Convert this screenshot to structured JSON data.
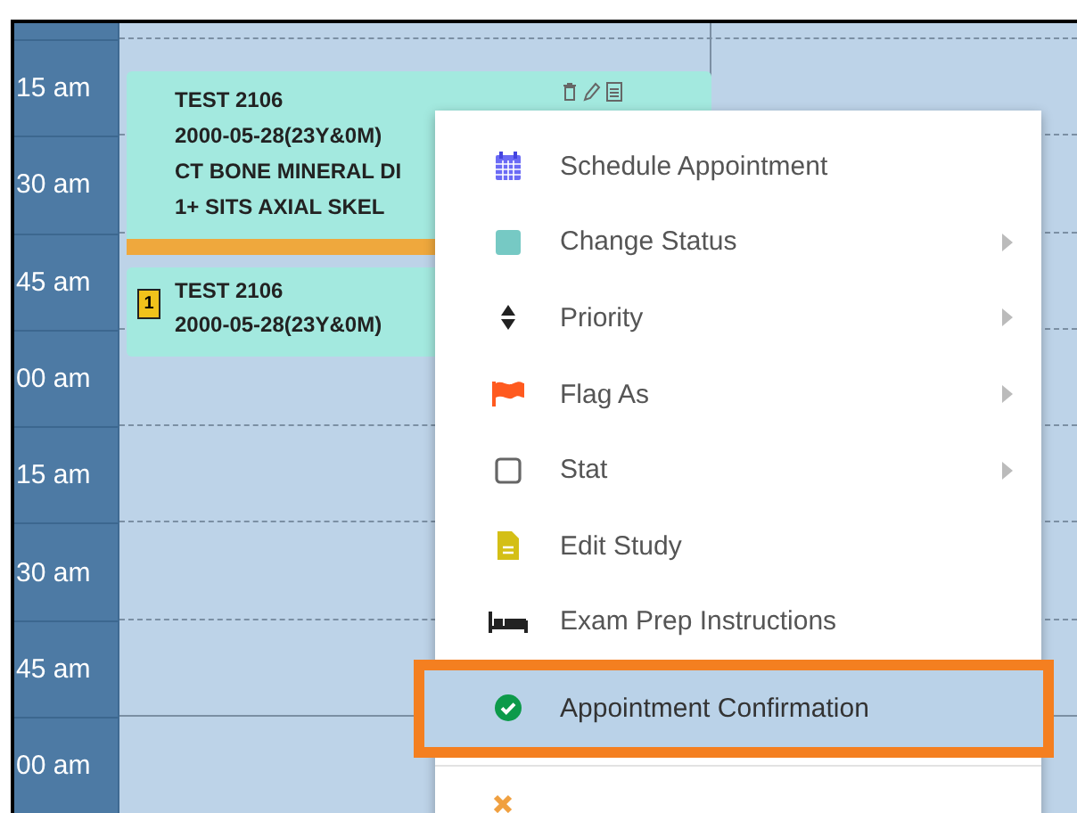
{
  "time_labels": [
    "15 am",
    "30 am",
    "45 am",
    "00 am",
    "15 am",
    "30 am",
    "45 am",
    "00 am"
  ],
  "appointments": [
    {
      "lines": [
        "TEST 2106",
        "2000-05-28(23Y&0M)",
        "CT BONE MINERAL DI",
        "1+ SITS AXIAL SKEL"
      ],
      "actions": true
    },
    {
      "lines": [
        "TEST 2106",
        "2000-05-28(23Y&0M)"
      ],
      "badge": "1",
      "actions": false
    }
  ],
  "context_menu": {
    "items": [
      {
        "label": "Schedule Appointment",
        "kind": "calendar",
        "submenu": false,
        "selected": false
      },
      {
        "label": "Change Status",
        "kind": "status",
        "submenu": true,
        "selected": false
      },
      {
        "label": "Priority",
        "kind": "sort",
        "submenu": true,
        "selected": false
      },
      {
        "label": "Flag As",
        "kind": "flag",
        "submenu": true,
        "selected": false
      },
      {
        "label": "Stat",
        "kind": "checkbox",
        "submenu": true,
        "selected": false
      },
      {
        "label": "Edit Study",
        "kind": "document",
        "submenu": false,
        "selected": false
      },
      {
        "label": "Exam Prep Instructions",
        "kind": "bed",
        "submenu": false,
        "selected": false
      },
      {
        "label": "Appointment Confirmation",
        "kind": "check",
        "submenu": false,
        "selected": true
      }
    ]
  }
}
